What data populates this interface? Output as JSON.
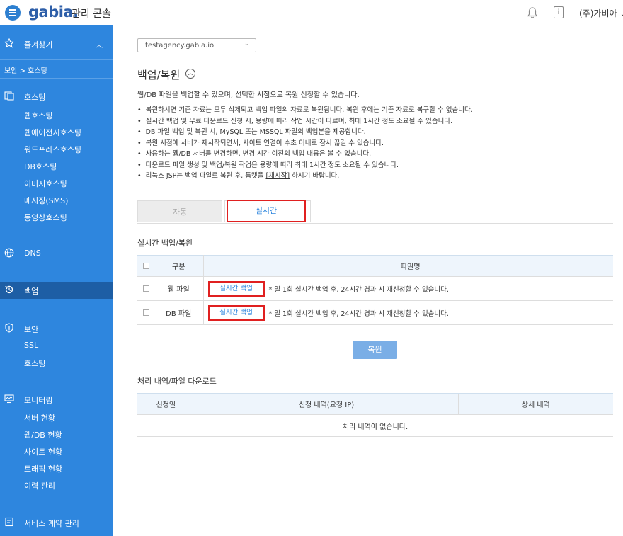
{
  "header": {
    "logo": "gabia.",
    "logo_sub": "관리 콘솔",
    "user_name": "(주)가비아",
    "info_icon_text": "i"
  },
  "sidebar": {
    "favorites": "즐겨찾기",
    "breadcrumb": "보안 > 호스팅",
    "groups": [
      {
        "label": "호스팅",
        "icon": "hosting-icon",
        "items": [
          "웹호스팅",
          "웹에이전시호스팅",
          "워드프레스호스팅",
          "DB호스팅",
          "이미지호스팅",
          "메시징(SMS)",
          "동영상호스팅"
        ]
      },
      {
        "label": "DNS",
        "icon": "globe-icon",
        "items": []
      },
      {
        "label": "백업",
        "icon": "backup-icon",
        "items": [],
        "active": true
      },
      {
        "label": "보안",
        "icon": "shield-icon",
        "items": [
          "SSL",
          "호스팅"
        ]
      },
      {
        "label": "모니터링",
        "icon": "monitor-icon",
        "items": [
          "서버 현황",
          "웹/DB 현황",
          "사이트 현황",
          "트래픽 현황",
          "이력 관리"
        ]
      },
      {
        "label": "서비스 계약 관리",
        "icon": "contract-icon",
        "items": []
      }
    ]
  },
  "main": {
    "domain_select": "testagency.gabia.io",
    "page_title": "백업/복원",
    "description": "웹/DB 파일을 백업할 수 있으며, 선택한 시점으로 복원 신청할 수 있습니다.",
    "notes": [
      "복원하시면 기존 자료는 모두 삭제되고 백업 파일의 자료로 복원됩니다. 복원 후에는 기존 자료로 복구할 수 없습니다.",
      "실시간 백업 및 무료 다운로드 신청 시, 용량에 따라 작업 시간이 다르며, 최대 1시간 정도 소요될 수 있습니다.",
      "DB 파일 백업 및 복원 시, MySQL 또는 MSSQL 파일의 백업본을 제공합니다.",
      "복원 시점에 서버가 재시작되면서, 사이트 연결이 수초 이내로 잠시 끊길 수 있습니다.",
      "사용하는 웹/DB 서버를 변경하면, 변경 시간 이전의 백업 내용은 볼 수 없습니다.",
      "다운로드 파일 생성 및 백업/복원 작업은 용량에 따라 최대 1시간 정도 소요될 수 있습니다."
    ],
    "note_last_prefix": "리눅스 JSP는 백업 파일로 복원 후, 톰캣을 ",
    "note_last_link": "[재시작]",
    "note_last_suffix": " 하시기 바랍니다.",
    "tabs": {
      "auto": "자동",
      "realtime": "실시간"
    },
    "realtime_section_title": "실시간 백업/복원",
    "table1": {
      "col_type": "구분",
      "col_file": "파일명",
      "rows": [
        {
          "type": "웹 파일",
          "button": "실시간 백업",
          "note": "* 일 1회 실시간 백업 후, 24시간 경과 시 재신청할 수 있습니다."
        },
        {
          "type": "DB 파일",
          "button": "실시간 백업",
          "note": "* 일 1회 실시간 백업 후, 24시간 경과 시 재신청할 수 있습니다."
        }
      ]
    },
    "restore_button": "복원",
    "history_section_title": "처리 내역/파일 다운로드",
    "table2": {
      "col_date": "신청일",
      "col_detail_ip": "신청 내역(요청 IP)",
      "col_detail": "상세 내역",
      "empty": "처리 내역이 없습니다."
    }
  },
  "colors": {
    "sidebar_bg": "#2e86de",
    "sidebar_active": "#1d5ea5",
    "accent_blue": "#2e86de",
    "highlight_red": "#e02020"
  }
}
